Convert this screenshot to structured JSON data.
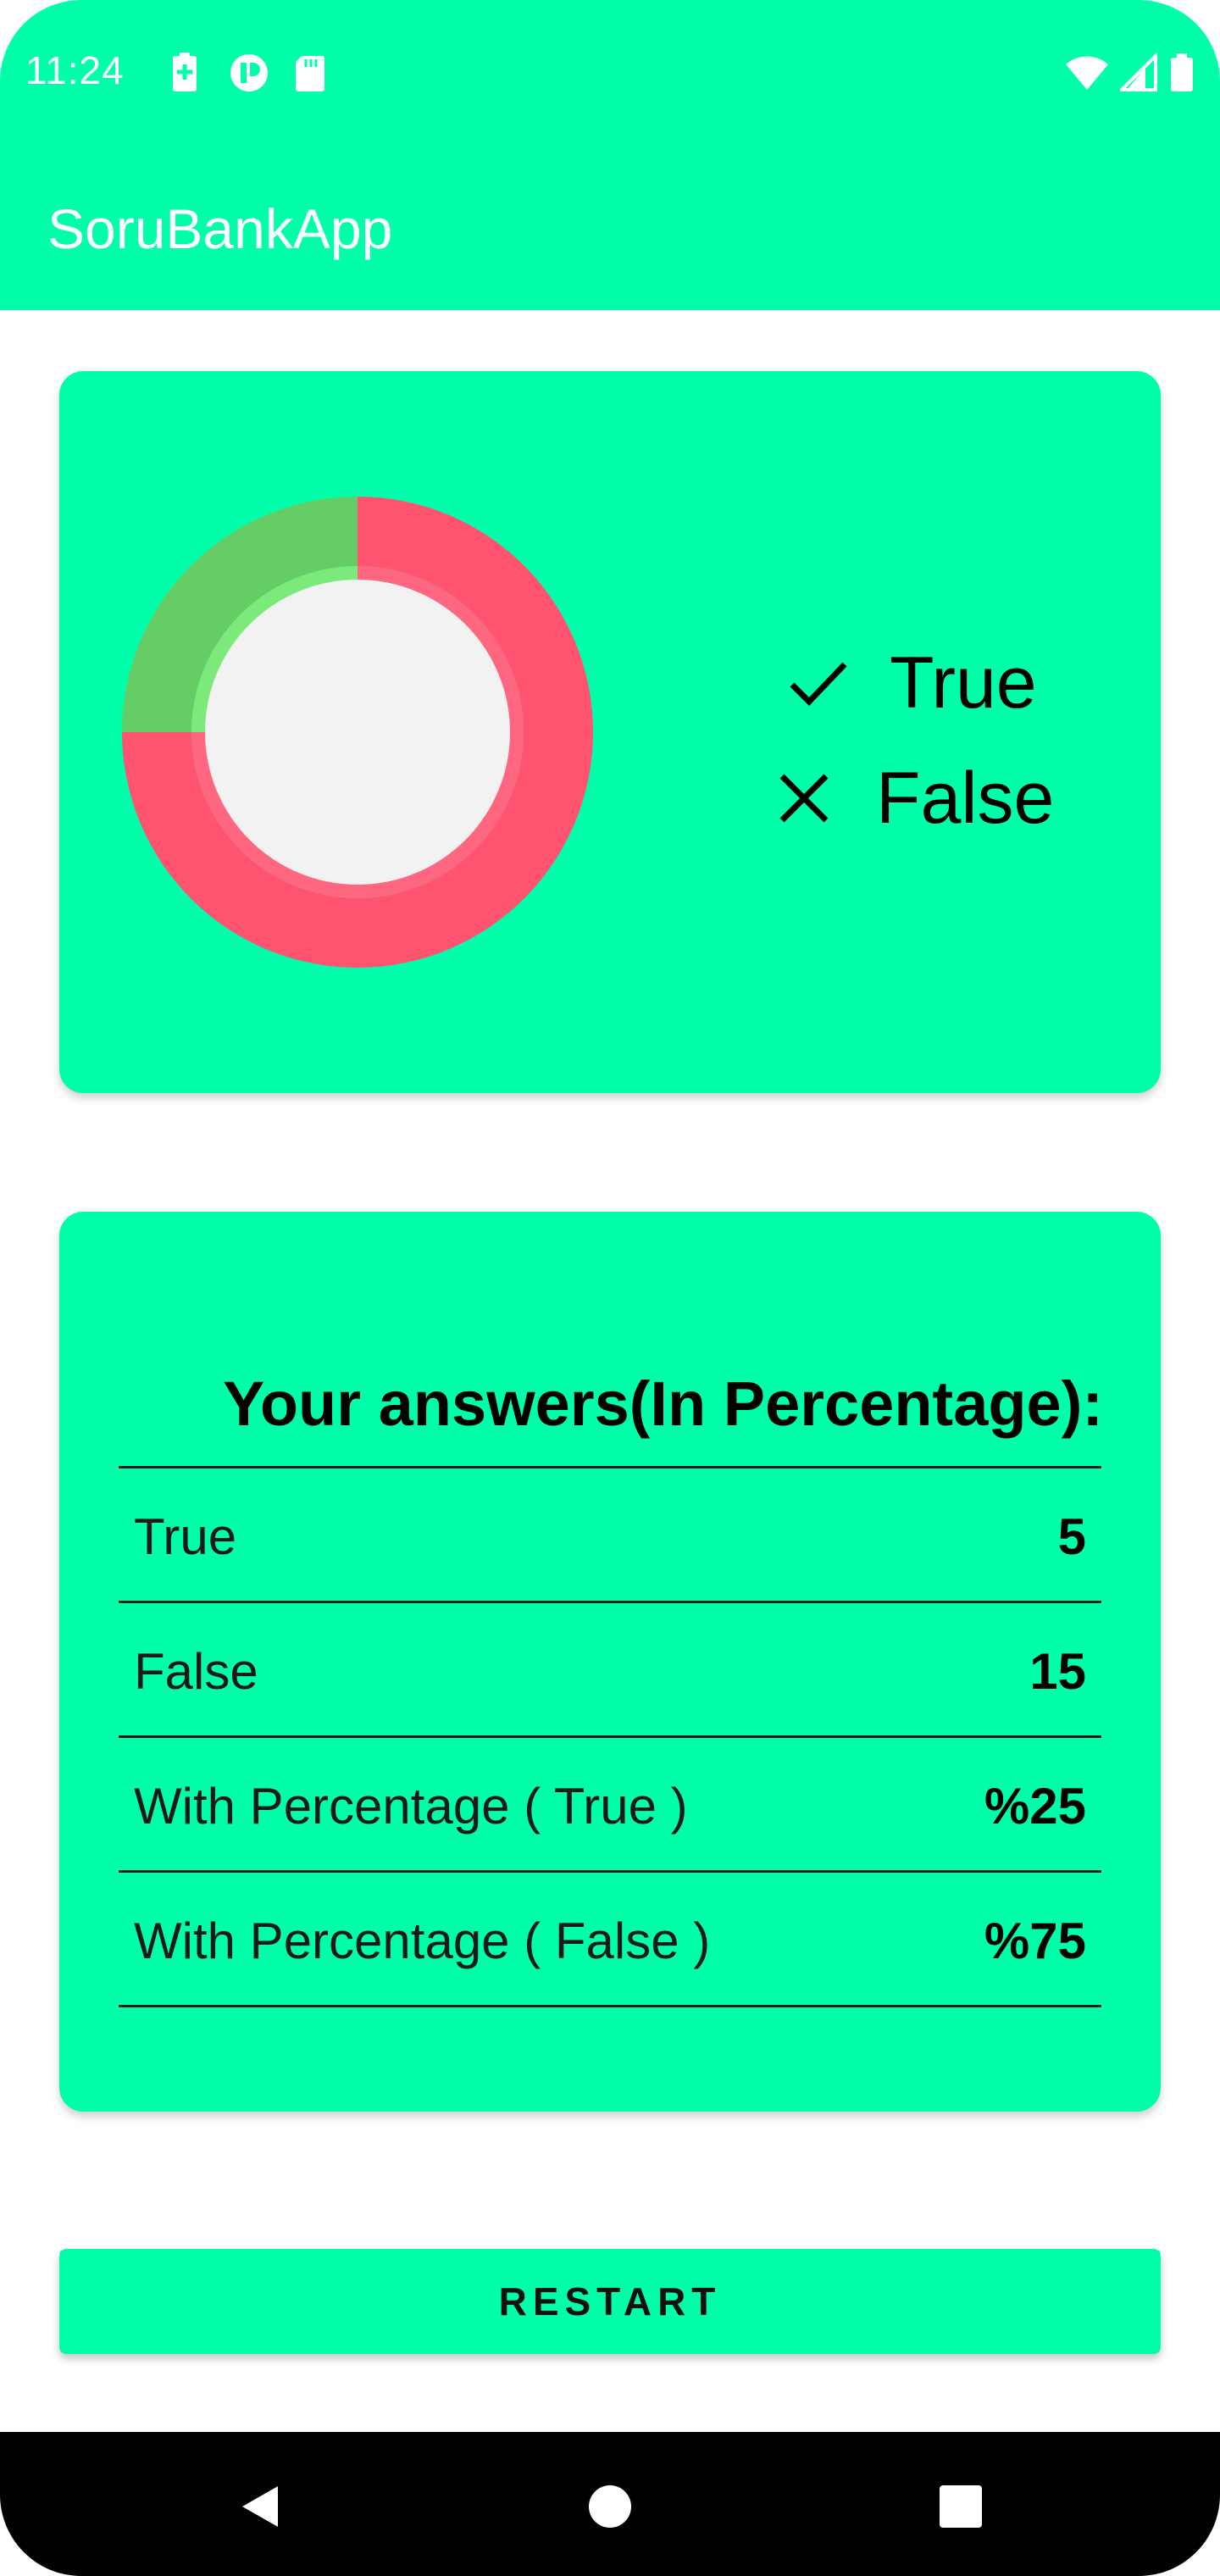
{
  "status_bar": {
    "time": "11:24",
    "icons_left": [
      "battery-charging-icon",
      "app-notification-icon",
      "sd-card-icon"
    ],
    "icons_right": [
      "wifi-icon",
      "cell-signal-icon",
      "battery-icon"
    ]
  },
  "app_bar": {
    "title": "SoruBankApp"
  },
  "colors": {
    "accent": "#00FFAA",
    "true_color": "#66CC66",
    "false_color": "#FF5370",
    "donut_center": "#F2F2F2"
  },
  "chart_data": {
    "type": "pie",
    "style": "donut",
    "slices": [
      {
        "label": "True",
        "value": 25
      },
      {
        "label": "False",
        "value": 75
      }
    ]
  },
  "legend": [
    {
      "icon": "checkmark-icon",
      "label": "True"
    },
    {
      "icon": "close-icon",
      "label": "False"
    }
  ],
  "table": {
    "title": "Your answers(In Percentage):",
    "rows": [
      {
        "label": "True",
        "value": "5"
      },
      {
        "label": "False",
        "value": "15"
      },
      {
        "label": "With Percentage ( True )",
        "value": "%25"
      },
      {
        "label": "With Percentage ( False )",
        "value": "%75"
      }
    ]
  },
  "restart_button": {
    "label": "RESTART"
  },
  "nav_bar": {
    "buttons": [
      "back-icon",
      "home-icon",
      "recents-icon"
    ]
  }
}
